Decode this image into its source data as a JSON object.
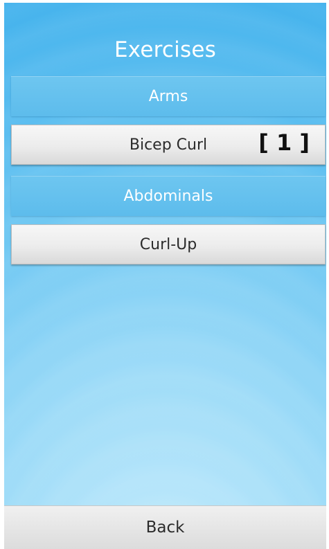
{
  "screen": {
    "title": "Exercises"
  },
  "sections": [
    {
      "header": "Arms",
      "items": [
        {
          "label": "Bicep Curl",
          "marker": "[ 1 ]"
        }
      ]
    },
    {
      "header": "Abdominals",
      "items": [
        {
          "label": "Curl-Up"
        }
      ]
    }
  ],
  "footer": {
    "back_label": "Back"
  },
  "colors": {
    "background_top": "#3fb0ec",
    "background_bottom": "#cbeefc",
    "section_header": "#5dbcec",
    "button_face": "#ececec",
    "text_dark": "#2b2b2b",
    "text_light": "#ffffff"
  }
}
